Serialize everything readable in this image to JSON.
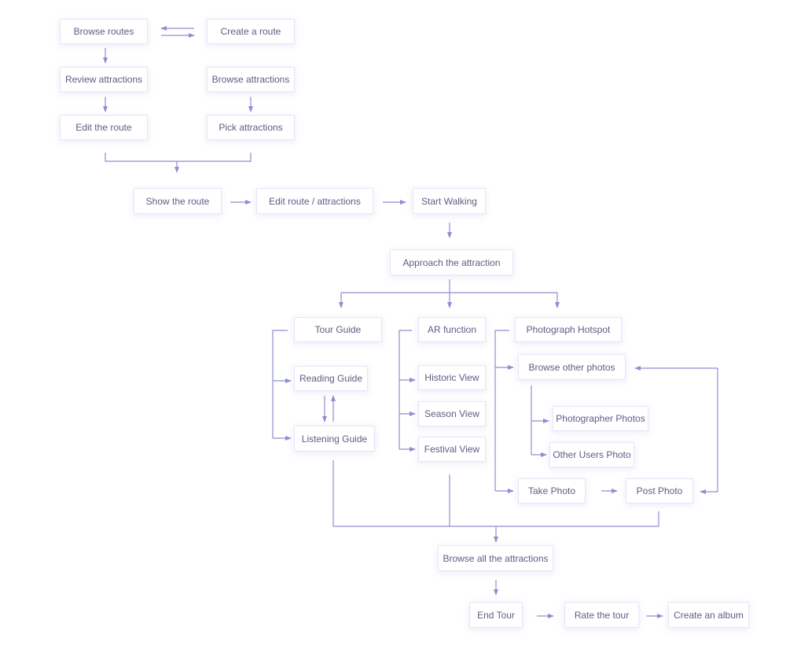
{
  "colors": {
    "line": "#8e8ed2",
    "text": "#5d5d85",
    "box_border": "#e6e6f7"
  },
  "nodes": [
    {
      "id": "browse-routes",
      "label": "Browse routes"
    },
    {
      "id": "create-route",
      "label": "Create a route"
    },
    {
      "id": "review-attractions",
      "label": "Review attractions"
    },
    {
      "id": "browse-attractions",
      "label": "Browse attractions"
    },
    {
      "id": "edit-route",
      "label": "Edit the route"
    },
    {
      "id": "pick-attractions",
      "label": "Pick attractions"
    },
    {
      "id": "show-route",
      "label": "Show the route"
    },
    {
      "id": "edit-route-attractions",
      "label": "Edit route / attractions"
    },
    {
      "id": "start-walking",
      "label": "Start Walking"
    },
    {
      "id": "approach-attraction",
      "label": "Approach the attraction"
    },
    {
      "id": "tour-guide",
      "label": "Tour Guide"
    },
    {
      "id": "ar-function",
      "label": "AR function"
    },
    {
      "id": "photograph-hotspot",
      "label": "Photograph Hotspot"
    },
    {
      "id": "browse-other-photos",
      "label": "Browse other photos"
    },
    {
      "id": "reading-guide",
      "label": "Reading Guide"
    },
    {
      "id": "historic-view",
      "label": "Historic View"
    },
    {
      "id": "season-view",
      "label": "Season View"
    },
    {
      "id": "photographer-photos",
      "label": "Photographer Photos"
    },
    {
      "id": "listening-guide",
      "label": "Listening Guide"
    },
    {
      "id": "festival-view",
      "label": "Festival View"
    },
    {
      "id": "other-users-photo",
      "label": "Other Users Photo"
    },
    {
      "id": "take-photo",
      "label": "Take Photo"
    },
    {
      "id": "post-photo",
      "label": "Post Photo"
    },
    {
      "id": "browse-all-attractions",
      "label": "Browse all the attractions"
    },
    {
      "id": "end-tour",
      "label": "End Tour"
    },
    {
      "id": "rate-tour",
      "label": "Rate the tour"
    },
    {
      "id": "create-album",
      "label": "Create an album"
    }
  ]
}
